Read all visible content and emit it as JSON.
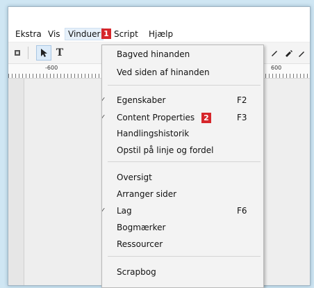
{
  "menubar": {
    "items": [
      {
        "label": "Ekstra"
      },
      {
        "label": "Vis"
      },
      {
        "label": "Vinduer"
      },
      {
        "label": "Script"
      },
      {
        "label": "Hjælp"
      }
    ],
    "badge1": "1"
  },
  "ruler": {
    "left_label": "-600",
    "right_label": "600"
  },
  "toolbar": {
    "text_tool_label": "T"
  },
  "menu": {
    "groups": [
      [
        {
          "label": "Bagved hinanden",
          "shortcut": "",
          "checked": false
        },
        {
          "label": "Ved siden af hinanden",
          "shortcut": "",
          "checked": false
        }
      ],
      [
        {
          "label": "Egenskaber",
          "shortcut": "F2",
          "checked": true
        },
        {
          "label": "Content Properties",
          "shortcut": "F3",
          "checked": true
        },
        {
          "label": "Handlingshistorik",
          "shortcut": "",
          "checked": false
        },
        {
          "label": "Opstil på linje og fordel",
          "shortcut": "",
          "checked": false
        }
      ],
      [
        {
          "label": "Oversigt",
          "shortcut": "",
          "checked": false
        },
        {
          "label": "Arranger sider",
          "shortcut": "",
          "checked": false
        },
        {
          "label": "Lag",
          "shortcut": "F6",
          "checked": true
        },
        {
          "label": "Bogmærker",
          "shortcut": "",
          "checked": false
        },
        {
          "label": "Ressourcer",
          "shortcut": "",
          "checked": false
        }
      ],
      [
        {
          "label": "Scrapbog",
          "shortcut": "",
          "checked": false
        }
      ]
    ],
    "badge2": "2",
    "check_glyph": "✓"
  },
  "colors": {
    "badge": "#d6262b",
    "selected_tool": "#dcebf9",
    "background": "#cfe6f3"
  }
}
